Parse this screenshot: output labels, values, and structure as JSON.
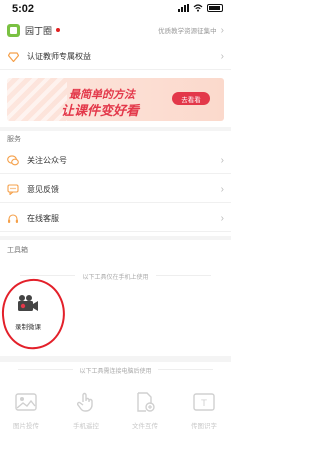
{
  "status": {
    "time": "5:02"
  },
  "app": {
    "name": "园丁圈",
    "slogan": "优质教学资源征集中"
  },
  "certify": {
    "label": "认证教师专属权益"
  },
  "banner": {
    "line1": "最简单的方法",
    "line2": "让课件变好看",
    "button": "去看看"
  },
  "services": {
    "title": "服务",
    "items": [
      {
        "label": "关注公众号",
        "icon": "wechat-icon"
      },
      {
        "label": "意见反馈",
        "icon": "feedback-icon"
      },
      {
        "label": "在线客服",
        "icon": "headset-icon"
      }
    ]
  },
  "toolbox": {
    "title": "工具箱",
    "phone_note": "以下工具仅在手机上使用",
    "record": {
      "label": "录制微课",
      "icon": "video-camera-icon"
    },
    "pc_note": "以下工具需连接电脑后使用",
    "pc_tools": [
      {
        "label": "图片投传",
        "icon": "image-upload-icon"
      },
      {
        "label": "手机遥控",
        "icon": "remote-control-icon"
      },
      {
        "label": "文件互传",
        "icon": "file-transfer-icon"
      },
      {
        "label": "传图识字",
        "icon": "ocr-icon"
      }
    ]
  },
  "colors": {
    "accent": "#e3384a",
    "brand": "#7ac142",
    "orange": "#f5a04a"
  }
}
